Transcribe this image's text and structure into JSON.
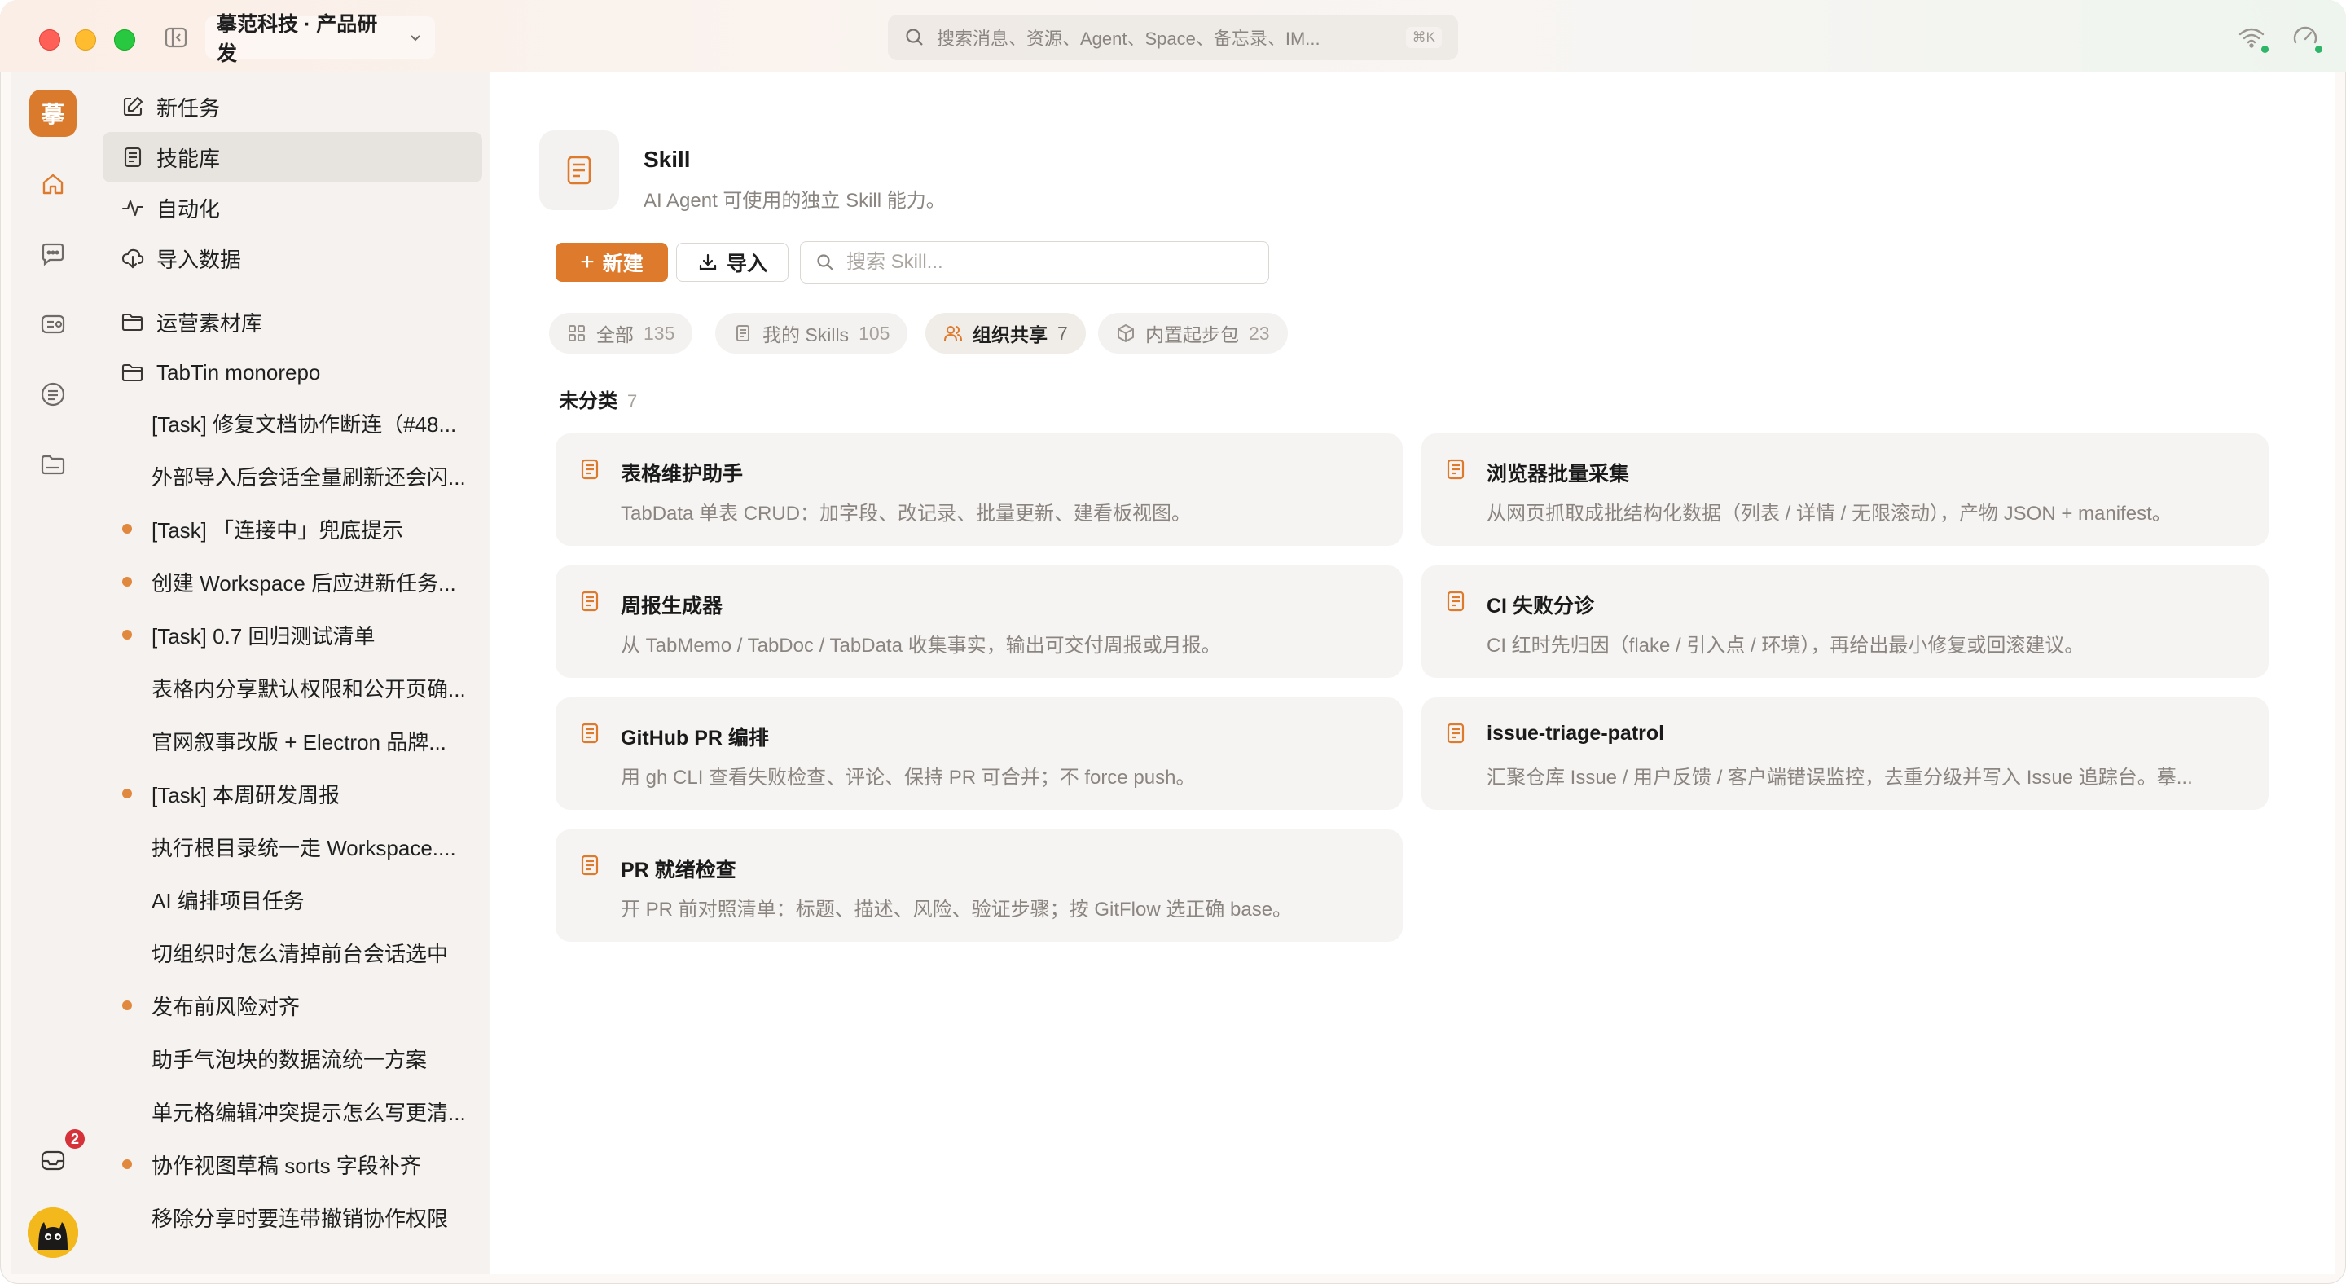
{
  "titlebar": {
    "workspace": "摹范科技 · 产品研发",
    "search_placeholder": "搜索消息、资源、Agent、Space、备忘录、IM...",
    "search_shortcut": "⌘K"
  },
  "rail": {
    "logo_text": "摹",
    "notification_count": "2"
  },
  "sidebar": {
    "nav": [
      {
        "label": "新任务",
        "icon": "edit-icon"
      },
      {
        "label": "技能库",
        "icon": "book-icon"
      },
      {
        "label": "自动化",
        "icon": "activity-icon"
      },
      {
        "label": "导入数据",
        "icon": "cloud-download-icon"
      }
    ],
    "folders": [
      {
        "label": "运营素材库"
      },
      {
        "label": "TabTin monorepo"
      }
    ],
    "tasks": [
      {
        "label": "[Task] 修复文档协作断连（#48...",
        "dot": false
      },
      {
        "label": "外部导入后会话全量刷新还会闪...",
        "dot": false
      },
      {
        "label": "[Task] 「连接中」兜底提示",
        "dot": true
      },
      {
        "label": "创建 Workspace 后应进新任务...",
        "dot": true
      },
      {
        "label": "[Task] 0.7 回归测试清单",
        "dot": true
      },
      {
        "label": "表格内分享默认权限和公开页确...",
        "dot": false
      },
      {
        "label": "官网叙事改版 + Electron 品牌...",
        "dot": false
      },
      {
        "label": "[Task] 本周研发周报",
        "dot": true
      },
      {
        "label": "执行根目录统一走 Workspace....",
        "dot": false
      },
      {
        "label": "AI 编排项目任务",
        "dot": false
      },
      {
        "label": "切组织时怎么清掉前台会话选中",
        "dot": false
      },
      {
        "label": "发布前风险对齐",
        "dot": true
      },
      {
        "label": "助手气泡块的数据流统一方案",
        "dot": false
      },
      {
        "label": "单元格编辑冲突提示怎么写更清...",
        "dot": false
      },
      {
        "label": "协作视图草稿 sorts 字段补齐",
        "dot": true
      },
      {
        "label": "移除分享时要连带撤销协作权限",
        "dot": false
      }
    ]
  },
  "main": {
    "title": "Skill",
    "subtitle": "AI Agent 可使用的独立 Skill 能力。",
    "new_label": "新建",
    "import_label": "导入",
    "search_placeholder": "搜索 Skill...",
    "tabs": [
      {
        "label": "全部",
        "count": "135",
        "icon": "grid-icon"
      },
      {
        "label": "我的 Skills",
        "count": "105",
        "icon": "document-icon"
      },
      {
        "label": "组织共享",
        "count": "7",
        "icon": "users-icon",
        "active": true
      },
      {
        "label": "内置起步包",
        "count": "23",
        "icon": "package-icon"
      }
    ],
    "section": {
      "title": "未分类",
      "count": "7"
    },
    "cards": [
      {
        "name": "表格维护助手",
        "desc": "TabData 单表 CRUD：加字段、改记录、批量更新、建看板视图。"
      },
      {
        "name": "浏览器批量采集",
        "desc": "从网页抓取成批结构化数据（列表 / 详情 / 无限滚动），产物 JSON + manifest。"
      },
      {
        "name": "周报生成器",
        "desc": "从 TabMemo / TabDoc / TabData 收集事实，输出可交付周报或月报。"
      },
      {
        "name": "CI 失败分诊",
        "desc": "CI 红时先归因（flake / 引入点 / 环境），再给出最小修复或回滚建议。"
      },
      {
        "name": "GitHub PR 编排",
        "desc": "用 gh CLI 查看失败检查、评论、保持 PR 可合并；不 force push。"
      },
      {
        "name": "issue-triage-patrol",
        "desc": "汇聚仓库 Issue / 用户反馈 / 客户端错误监控，去重分级并写入 Issue 追踪台。摹..."
      },
      {
        "name": "PR 就绪检查",
        "desc": "开 PR 前对照清单：标题、描述、风险、验证步骤；按 GitFlow 选正确 base。"
      }
    ]
  },
  "colors": {
    "accent": "#de7a2c",
    "dot": "#e0893e",
    "badge": "#d6323a"
  }
}
